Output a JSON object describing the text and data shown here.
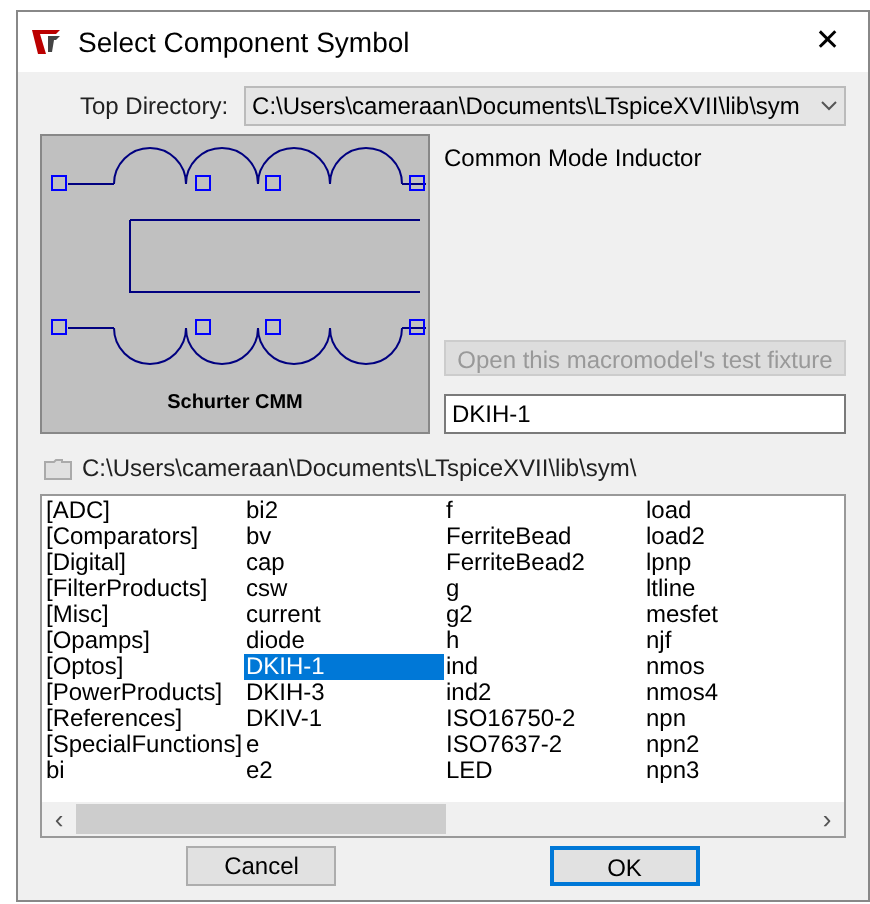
{
  "window": {
    "title": "Select Component Symbol",
    "close": "✕"
  },
  "top_directory": {
    "label": "Top Directory:",
    "value": "C:\\Users\\cameraan\\Documents\\LTspiceXVII\\lib\\sym"
  },
  "preview": {
    "caption": "Schurter CMM"
  },
  "description": "Common Mode Inductor",
  "test_fixture_button": {
    "label": "Open this macromodel's test fixture",
    "disabled": true
  },
  "name_field": {
    "value": "DKIH-1"
  },
  "current_path": "C:\\Users\\cameraan\\Documents\\LTspiceXVII\\lib\\sym\\",
  "file_list": {
    "columns": [
      [
        {
          "label": "[ADC]",
          "selected": false
        },
        {
          "label": "[Comparators]",
          "selected": false
        },
        {
          "label": "[Digital]",
          "selected": false
        },
        {
          "label": "[FilterProducts]",
          "selected": false
        },
        {
          "label": "[Misc]",
          "selected": false
        },
        {
          "label": "[Opamps]",
          "selected": false
        },
        {
          "label": "[Optos]",
          "selected": false
        },
        {
          "label": "[PowerProducts]",
          "selected": false
        },
        {
          "label": "[References]",
          "selected": false
        },
        {
          "label": "[SpecialFunctions]",
          "selected": false
        },
        {
          "label": "bi",
          "selected": false
        }
      ],
      [
        {
          "label": "bi2",
          "selected": false
        },
        {
          "label": "bv",
          "selected": false
        },
        {
          "label": "cap",
          "selected": false
        },
        {
          "label": "csw",
          "selected": false
        },
        {
          "label": "current",
          "selected": false
        },
        {
          "label": "diode",
          "selected": false
        },
        {
          "label": "DKIH-1",
          "selected": true
        },
        {
          "label": "DKIH-3",
          "selected": false
        },
        {
          "label": "DKIV-1",
          "selected": false
        },
        {
          "label": "e",
          "selected": false
        },
        {
          "label": "e2",
          "selected": false
        }
      ],
      [
        {
          "label": "f",
          "selected": false
        },
        {
          "label": "FerriteBead",
          "selected": false
        },
        {
          "label": "FerriteBead2",
          "selected": false
        },
        {
          "label": "g",
          "selected": false
        },
        {
          "label": "g2",
          "selected": false
        },
        {
          "label": "h",
          "selected": false
        },
        {
          "label": "ind",
          "selected": false
        },
        {
          "label": "ind2",
          "selected": false
        },
        {
          "label": "ISO16750-2",
          "selected": false
        },
        {
          "label": "ISO7637-2",
          "selected": false
        },
        {
          "label": "LED",
          "selected": false
        }
      ],
      [
        {
          "label": "load",
          "selected": false
        },
        {
          "label": "load2",
          "selected": false
        },
        {
          "label": "lpnp",
          "selected": false
        },
        {
          "label": "ltline",
          "selected": false
        },
        {
          "label": "mesfet",
          "selected": false
        },
        {
          "label": "njf",
          "selected": false
        },
        {
          "label": "nmos",
          "selected": false
        },
        {
          "label": "nmos4",
          "selected": false
        },
        {
          "label": "npn",
          "selected": false
        },
        {
          "label": "npn2",
          "selected": false
        },
        {
          "label": "npn3",
          "selected": false
        }
      ]
    ],
    "scroll_left": "‹",
    "scroll_right": "›"
  },
  "buttons": [
    {
      "label": "Cancel",
      "default": false
    },
    {
      "label": "OK",
      "default": true
    }
  ]
}
